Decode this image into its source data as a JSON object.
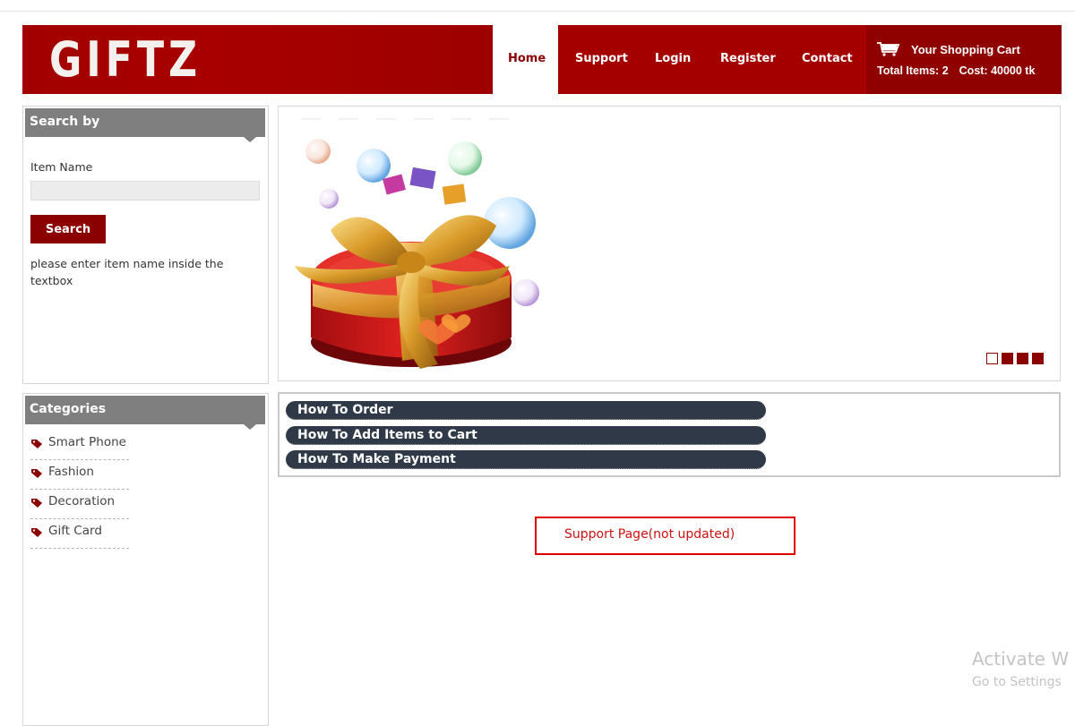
{
  "header": {
    "logo": "GIFTZ",
    "nav": [
      "Home",
      "Support",
      "Login",
      "Register",
      "Contact"
    ],
    "active_nav": "Home"
  },
  "cart": {
    "title": "Your Shopping Cart",
    "total_items_label": "Total Items: 2",
    "cost_label": "Cost: 40000 tk",
    "icon": "shopping-cart-icon"
  },
  "search_panel": {
    "title": "Search by",
    "field_label": "Item Name",
    "input_value": "",
    "button_label": "Search",
    "help_text": "please enter item name inside the textbox"
  },
  "categories_panel": {
    "title": "Categories",
    "items": [
      "Smart Phone",
      "Fashion",
      "Decoration",
      "Gift Card"
    ]
  },
  "slider": {
    "image": "gift-box-with-bubbles",
    "slide_count": 4,
    "active_slide": 1
  },
  "accordion": {
    "items": [
      "How To Order",
      "How To Add Items to Cart",
      "How To Make Payment"
    ]
  },
  "notice": "Support Page(not updated)",
  "watermark": {
    "line1": "Activate W",
    "line2": "Go to Settings"
  },
  "colors": {
    "brand_red": "#a50000",
    "dark_red": "#8b0000",
    "panel_gray": "#7f7f7f",
    "accordion_navy": "#2f3948",
    "notice_red": "#e00000"
  }
}
